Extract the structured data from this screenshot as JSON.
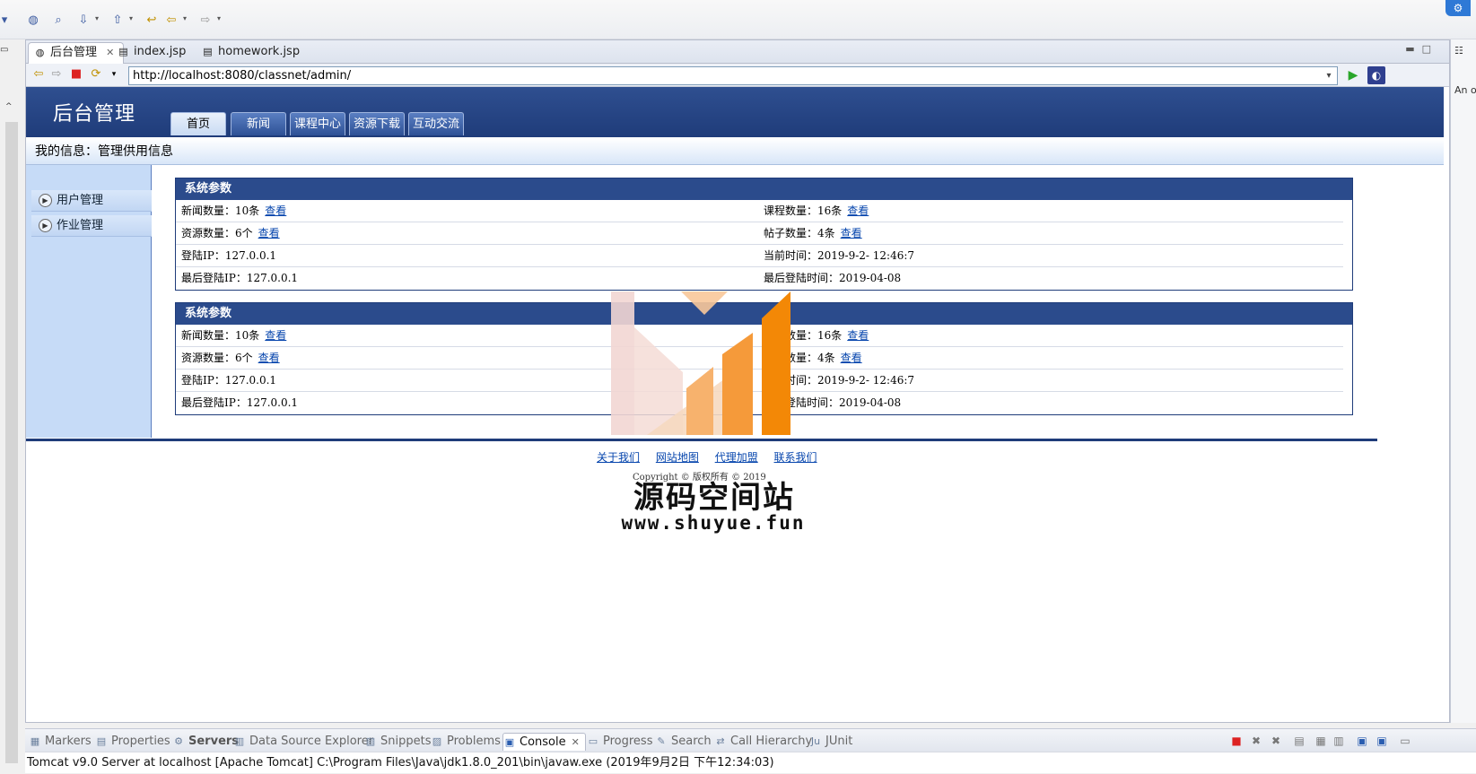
{
  "editor_tabs": [
    {
      "label": "后台管理",
      "active": true
    },
    {
      "label": "index.jsp",
      "active": false
    },
    {
      "label": "homework.jsp",
      "active": false
    }
  ],
  "browser": {
    "url": "http://localhost:8080/classnet/admin/"
  },
  "site": {
    "title": "后台管理",
    "nav_tabs": [
      "首页",
      "新闻",
      "课程中心",
      "资源下载",
      "互动交流"
    ],
    "info_bar": "我的信息：管理供用信息",
    "side_menu": [
      "用户管理",
      "作业管理"
    ]
  },
  "panels": [
    {
      "title": "系统参数",
      "rows": [
        {
          "left": "新闻数量：10条",
          "left_link": "查看",
          "right": "课程数量：16条",
          "right_link": "查看"
        },
        {
          "left": "资源数量：6个",
          "left_link": "查看",
          "right": "帖子数量：4条",
          "right_link": "查看"
        },
        {
          "left": "登陆IP：127.0.0.1",
          "left_link": "",
          "right": "当前时间：2019-9-2- 12:46:7",
          "right_link": ""
        },
        {
          "left": "最后登陆IP：127.0.0.1",
          "left_link": "",
          "right": "最后登陆时间：2019-04-08",
          "right_link": ""
        }
      ]
    },
    {
      "title": "系统参数",
      "rows": [
        {
          "left": "新闻数量：10条",
          "left_link": "查看",
          "right": "课程数量：16条",
          "right_link": "查看"
        },
        {
          "left": "资源数量：6个",
          "left_link": "查看",
          "right": "帖子数量：4条",
          "right_link": "查看"
        },
        {
          "left": "登陆IP：127.0.0.1",
          "left_link": "",
          "right": "当前时间：2019-9-2- 12:46:7",
          "right_link": ""
        },
        {
          "left": "最后登陆IP：127.0.0.1",
          "left_link": "",
          "right": "最后登陆时间：2019-04-08",
          "right_link": ""
        }
      ]
    }
  ],
  "footer": {
    "links": [
      "关于我们",
      "网站地图",
      "代理加盟",
      "联系我们"
    ],
    "copyright": "Copyright © 版权所有 © 2019"
  },
  "watermark": {
    "text": "源码空间站",
    "url": "www.shuyue.fun"
  },
  "right_panel": {
    "text": "An o"
  },
  "bottom_tabs": [
    {
      "label": "Markers",
      "icon": "markers-icon"
    },
    {
      "label": "Properties",
      "icon": "properties-icon"
    },
    {
      "label": "Servers",
      "icon": "servers-icon",
      "bold": true
    },
    {
      "label": "Data Source Explorer",
      "icon": "data-source-icon"
    },
    {
      "label": "Snippets",
      "icon": "snippets-icon"
    },
    {
      "label": "Problems",
      "icon": "problems-icon"
    },
    {
      "label": "Console",
      "icon": "console-icon",
      "active": true
    },
    {
      "label": "Progress",
      "icon": "progress-icon"
    },
    {
      "label": "Search",
      "icon": "search-icon"
    },
    {
      "label": "Call Hierarchy",
      "icon": "call-hierarchy-icon"
    },
    {
      "label": "JUnit",
      "icon": "junit-icon"
    }
  ],
  "console_text": "Tomcat v9.0 Server at localhost [Apache Tomcat] C:\\Program Files\\Java\\jdk1.8.0_201\\bin\\javaw.exe (2019年9月2日 下午12:34:03)",
  "colors": {
    "header_blue": "#2b4b8c",
    "side_blue": "#c6dbf7",
    "link": "#0645ad"
  }
}
